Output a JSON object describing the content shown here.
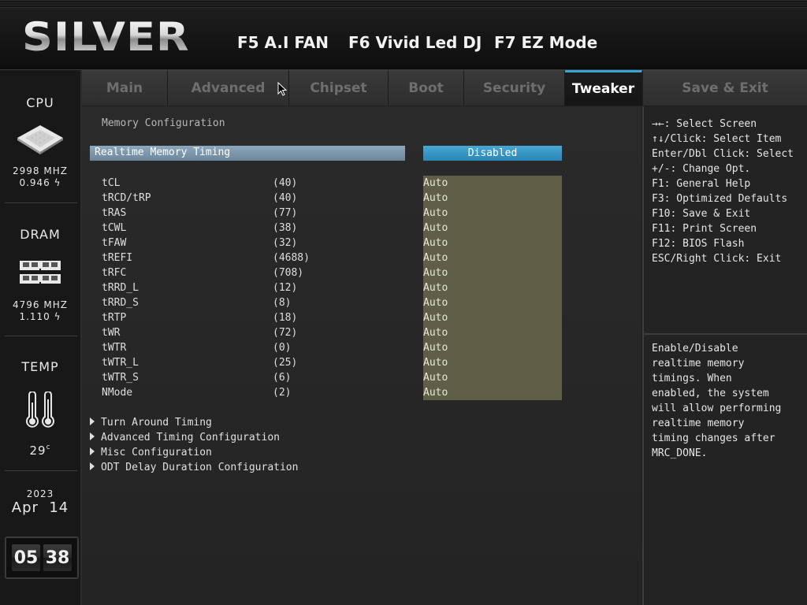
{
  "header": {
    "logo": "SILVER",
    "hotkeys": [
      "F5 A.I FAN",
      "F6 Vivid Led DJ",
      "F7 EZ Mode"
    ]
  },
  "sidebar": {
    "cpu_label": "CPU",
    "cpu_freq": "2998 MHZ",
    "cpu_volt": "0.946",
    "dram_label": "DRAM",
    "dram_freq": "4796 MHZ",
    "dram_volt": "1.110",
    "temp_label": "TEMP",
    "temp_value": "29",
    "year": "2023",
    "date": "Apr  14",
    "hour": "05",
    "minute": "38"
  },
  "tabs": [
    {
      "label": "Main",
      "active": false
    },
    {
      "label": "Advanced",
      "active": false
    },
    {
      "label": "Chipset",
      "active": false
    },
    {
      "label": "Boot",
      "active": false
    },
    {
      "label": "Security",
      "active": false
    },
    {
      "label": "Tweaker",
      "active": true
    },
    {
      "label": "Save & Exit",
      "active": false
    }
  ],
  "main": {
    "section_title": "Memory Configuration",
    "realtime_label": "Realtime Memory Timing",
    "realtime_value": "Disabled",
    "timings": [
      {
        "name": "tCL",
        "value": "(40)",
        "setting": "Auto"
      },
      {
        "name": "tRCD/tRP",
        "value": "(40)",
        "setting": "Auto"
      },
      {
        "name": "tRAS",
        "value": "(77)",
        "setting": "Auto"
      },
      {
        "name": "tCWL",
        "value": "(38)",
        "setting": "Auto"
      },
      {
        "name": "tFAW",
        "value": "(32)",
        "setting": "Auto"
      },
      {
        "name": "tREFI",
        "value": "(4688)",
        "setting": "Auto"
      },
      {
        "name": "tRFC",
        "value": "(708)",
        "setting": "Auto"
      },
      {
        "name": "tRRD_L",
        "value": "(12)",
        "setting": "Auto"
      },
      {
        "name": "tRRD_S",
        "value": "(8)",
        "setting": "Auto"
      },
      {
        "name": "tRTP",
        "value": "(18)",
        "setting": "Auto"
      },
      {
        "name": "tWR",
        "value": "(72)",
        "setting": "Auto"
      },
      {
        "name": "tWTR",
        "value": "(0)",
        "setting": "Auto"
      },
      {
        "name": "tWTR_L",
        "value": "(25)",
        "setting": "Auto"
      },
      {
        "name": "tWTR_S",
        "value": "(6)",
        "setting": "Auto"
      },
      {
        "name": "NMode",
        "value": "(2)",
        "setting": "Auto"
      }
    ],
    "submenus": [
      "Turn Around Timing",
      "Advanced Timing Configuration",
      "Misc Configuration",
      "ODT Delay Duration Configuration"
    ]
  },
  "help": {
    "keys": [
      "→←: Select Screen",
      "↑↓/Click: Select Item",
      "Enter/Dbl Click: Select",
      "+/-: Change Opt.",
      "F1: General Help",
      "F3: Optimized Defaults",
      "F10: Save & Exit",
      "F11: Print Screen",
      "F12: BIOS Flash",
      "ESC/Right Click: Exit"
    ],
    "description": [
      "Enable/Disable",
      "realtime memory",
      "timings. When",
      "enabled, the system",
      "will allow performing",
      "realtime memory",
      "timing changes after",
      "MRC_DONE."
    ]
  },
  "colors": {
    "accent": "#38a6d6",
    "auto_bg": "#5f5f47",
    "selected_row": "#7f99af"
  }
}
